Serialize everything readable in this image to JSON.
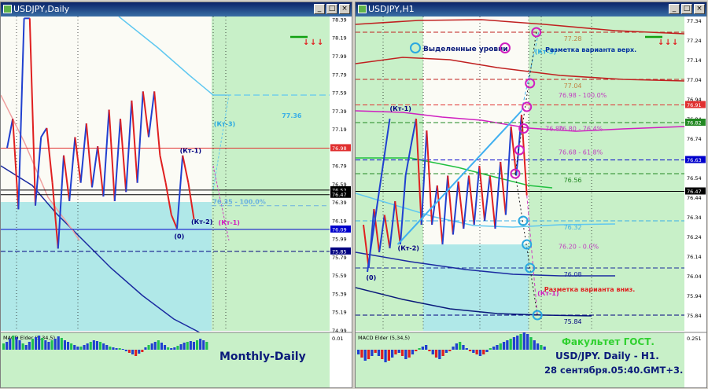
{
  "windows": [
    {
      "id": "left",
      "title": "USDJPY,Daily",
      "buttons": [
        "_",
        "□",
        "×"
      ]
    },
    {
      "id": "right",
      "title": "USDJPY,H1",
      "buttons": [
        "_",
        "□",
        "×"
      ]
    }
  ],
  "chart_data": [
    {
      "type": "line",
      "window": "left",
      "ylim": [
        74.98,
        78.42
      ],
      "yticks": [
        78.39,
        78.19,
        77.99,
        77.79,
        77.59,
        77.39,
        77.19,
        76.99,
        76.79,
        76.59,
        76.39,
        76.19,
        75.99,
        75.79,
        75.59,
        75.39,
        75.19,
        74.99
      ],
      "price_tags": [
        {
          "value": 76.98,
          "label": "76.98",
          "color": "#e03030"
        },
        {
          "value": 76.52,
          "label": "76.52",
          "color": "#000000"
        },
        {
          "value": 76.47,
          "label": "76.47",
          "color": "#000000"
        },
        {
          "value": 76.09,
          "label": "76.09",
          "color": "#0000cc"
        },
        {
          "value": 75.85,
          "label": "75.85",
          "color": "#000080"
        }
      ],
      "price_path": [
        [
          0,
          76.98
        ],
        [
          1,
          77.3
        ],
        [
          2,
          76.31
        ],
        [
          3,
          78.4
        ],
        [
          4,
          78.4
        ],
        [
          5,
          76.35
        ],
        [
          6,
          77.1
        ],
        [
          7,
          77.2
        ],
        [
          8,
          76.6
        ],
        [
          9,
          75.88
        ],
        [
          10,
          76.9
        ],
        [
          11,
          76.4
        ],
        [
          12,
          77.1
        ],
        [
          13,
          76.6
        ],
        [
          14,
          77.25
        ],
        [
          15,
          76.55
        ],
        [
          16,
          77.0
        ],
        [
          17,
          76.45
        ],
        [
          18,
          77.4
        ],
        [
          19,
          76.4
        ],
        [
          20,
          77.3
        ],
        [
          21,
          76.5
        ],
        [
          22,
          77.5
        ],
        [
          23,
          76.6
        ],
        [
          24,
          77.6
        ],
        [
          25,
          77.1
        ],
        [
          26,
          77.6
        ],
        [
          27,
          76.9
        ],
        [
          28,
          76.6
        ],
        [
          29,
          76.25
        ],
        [
          30,
          76.1
        ],
        [
          31,
          76.9
        ],
        [
          32,
          76.6
        ],
        [
          33,
          76.2
        ]
      ],
      "up_color": "#2040d0",
      "down_color": "#e02020",
      "levels": [
        {
          "value": 76.98,
          "color": "#e03030",
          "dash": false
        },
        {
          "value": 76.52,
          "color": "#000000",
          "dash": false
        },
        {
          "value": 76.47,
          "color": "#000000",
          "dash": false
        },
        {
          "value": 76.09,
          "color": "#0000cc",
          "dash": false
        },
        {
          "value": 75.85,
          "color": "#000080",
          "dash": true
        }
      ],
      "annotations": [
        {
          "text": "(Кт-1)",
          "x": 30.5,
          "y": 76.93,
          "color": "#000080"
        },
        {
          "text": "(Кт-2)",
          "x": 32.5,
          "y": 76.15,
          "color": "#000080"
        },
        {
          "text": "(0)",
          "x": 29.5,
          "y": 75.99,
          "color": "#000080"
        },
        {
          "text": "(Кт-3)",
          "x": 36.5,
          "y": 77.22,
          "color": "#2aa8e0"
        },
        {
          "text": "(Кт-1)",
          "x": 37.3,
          "y": 76.14,
          "color": "#d020c0"
        },
        {
          "text": "76.35 - 100.0%",
          "x": 36.3,
          "y": 76.37,
          "color": "#6ab0e0"
        },
        {
          "text": "77.36",
          "x": 48.5,
          "y": 77.31,
          "color": "#3aaee6"
        }
      ],
      "indicator": {
        "label": "MACD Elder (5,34,5)",
        "scale_top": "0.01"
      },
      "caption": "Monthly-Daily"
    },
    {
      "type": "line",
      "window": "right",
      "ylim": [
        75.76,
        77.36
      ],
      "yticks": [
        77.34,
        77.24,
        77.14,
        77.04,
        76.94,
        76.84,
        76.74,
        76.64,
        76.54,
        76.44,
        76.34,
        76.24,
        76.14,
        76.04,
        75.94,
        75.84
      ],
      "price_tags": [
        {
          "value": 76.91,
          "label": "76.91",
          "color": "#e03030"
        },
        {
          "value": 76.82,
          "label": "76.82",
          "color": "#228822"
        },
        {
          "value": 76.63,
          "label": "76.63",
          "color": "#0000cc"
        },
        {
          "value": 76.47,
          "label": "76.47",
          "color": "#000000"
        }
      ],
      "price_path": [
        [
          0,
          76.3
        ],
        [
          1,
          76.08
        ],
        [
          2,
          76.38
        ],
        [
          3,
          76.16
        ],
        [
          4,
          76.35
        ],
        [
          5,
          76.18
        ],
        [
          6,
          76.42
        ],
        [
          7,
          76.2
        ],
        [
          8,
          76.55
        ],
        [
          9,
          76.7
        ],
        [
          10,
          76.84
        ],
        [
          11,
          76.3
        ],
        [
          12,
          76.78
        ],
        [
          13,
          76.3
        ],
        [
          14,
          76.5
        ],
        [
          15,
          76.2
        ],
        [
          16,
          76.55
        ],
        [
          17,
          76.25
        ],
        [
          18,
          76.52
        ],
        [
          19,
          76.28
        ],
        [
          20,
          76.55
        ],
        [
          21,
          76.3
        ],
        [
          22,
          76.6
        ],
        [
          23,
          76.32
        ],
        [
          24,
          76.55
        ],
        [
          25,
          76.28
        ],
        [
          26,
          76.62
        ],
        [
          27,
          76.35
        ],
        [
          28,
          76.8
        ],
        [
          29,
          76.55
        ],
        [
          30,
          76.86
        ],
        [
          31,
          76.45
        ]
      ],
      "up_color": "#2040d0",
      "down_color": "#e02020",
      "levels": [
        {
          "value": 77.28,
          "color": "#c02020",
          "dash": true,
          "label": "77.28",
          "lx": 38,
          "lcolor": "#c08040"
        },
        {
          "value": 77.04,
          "color": "#c02020",
          "dash": true,
          "label": "77.04",
          "lx": 38,
          "lcolor": "#c08040"
        },
        {
          "value": 76.91,
          "color": "#e03030",
          "dash": true
        },
        {
          "value": 76.82,
          "color": "#228822",
          "dash": true
        },
        {
          "value": 76.63,
          "color": "#0000cc",
          "dash": true
        },
        {
          "value": 76.56,
          "color": "#228822",
          "dash": true,
          "label": "76.56",
          "lx": 38,
          "lcolor": "#228822"
        },
        {
          "value": 76.47,
          "color": "#000000",
          "dash": false
        },
        {
          "value": 76.32,
          "color": "#3aaee6",
          "dash": true,
          "label": "76.32",
          "lx": 38,
          "lcolor": "#3aaee6"
        },
        {
          "value": 76.08,
          "color": "#1a2a9a",
          "dash": true,
          "label": "76.08",
          "lx": 38,
          "lcolor": "#1a2a9a"
        },
        {
          "value": 75.84,
          "color": "#000080",
          "dash": true,
          "label": "75.84",
          "lx": 38,
          "lcolor": "#000080"
        }
      ],
      "fib_labels": [
        {
          "text": "76.98 - 100.0%",
          "value": 76.96,
          "x": 37,
          "color": "#c040c0"
        },
        {
          "text": "76.80 - 76.4%",
          "value": 76.79,
          "x": 37,
          "color": "#c040c0"
        },
        {
          "text": "76.68 - 61.8%",
          "value": 76.67,
          "x": 37,
          "color": "#c040c0"
        },
        {
          "text": "76.80",
          "value": 76.79,
          "x": 34.5,
          "color": "#c040c0"
        },
        {
          "text": "76.20 - 0.0%",
          "value": 76.19,
          "x": 37,
          "color": "#c040c0"
        }
      ],
      "circles": [
        {
          "x": 32.8,
          "y": 77.28
        },
        {
          "x": 31.6,
          "y": 77.02
        },
        {
          "x": 31.0,
          "y": 76.9
        },
        {
          "x": 30.4,
          "y": 76.79
        },
        {
          "x": 29.6,
          "y": 76.68
        },
        {
          "x": 28.8,
          "y": 76.56
        },
        {
          "x": 30.3,
          "y": 76.32
        },
        {
          "x": 31.0,
          "y": 76.2
        },
        {
          "x": 31.6,
          "y": 76.08
        },
        {
          "x": 33.0,
          "y": 75.84
        }
      ],
      "annotations": [
        {
          "text": "(Кт-1)",
          "x": 5,
          "y": 76.88,
          "color": "#000080"
        },
        {
          "text": "(Кт-2)",
          "x": 6.5,
          "y": 76.17,
          "color": "#000080"
        },
        {
          "text": "(0)",
          "x": 0.5,
          "y": 76.02,
          "color": "#000080"
        },
        {
          "text": "(Кт-3)",
          "x": 32.5,
          "y": 77.17,
          "color": "#2aa8e0"
        },
        {
          "text": "(Кт-1)",
          "x": 33.0,
          "y": 75.94,
          "color": "#d020c0"
        }
      ],
      "legend": {
        "text": "Выделенные уровни",
        "left_color": "#2aa8e0",
        "right_color": "#d020c0"
      },
      "notes": [
        {
          "text": "Разметка варианта верх.",
          "x": 34.5,
          "y": 77.18,
          "color": "#0030a0"
        },
        {
          "text": "Разметка варианта вниз.",
          "x": 34.3,
          "y": 75.96,
          "color": "#e02020"
        }
      ],
      "indicator": {
        "label": "MACD Elder (5,34,5)",
        "scale_top": "0.251"
      },
      "captions": [
        "Факультет ГОСТ.",
        "USD/JPY. Daily - H1.",
        "28 сентября.05:40.GMT+3."
      ]
    }
  ]
}
